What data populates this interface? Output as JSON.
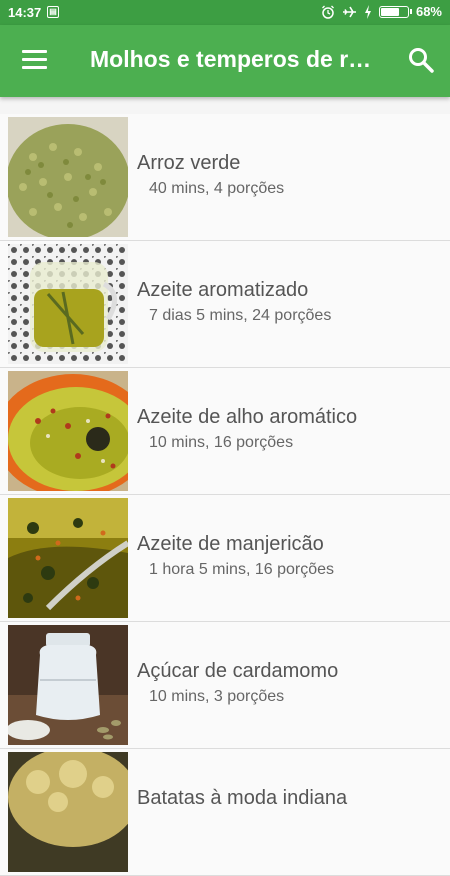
{
  "status_bar": {
    "time": "14:37",
    "sim_icon": "sim-card-icon",
    "battery": "68%",
    "battery_level": 0.68,
    "icons": [
      "alarm-icon",
      "airplane-icon",
      "charging-icon",
      "battery-icon"
    ]
  },
  "app_bar": {
    "menu_icon": "hamburger-menu-icon",
    "title": "Molhos e temperos de r…",
    "search_icon": "search-icon",
    "color": "#4caf50"
  },
  "recipes": [
    {
      "name": "Arroz verde",
      "meta": "40 mins, 4 porções",
      "image": "green-rice-photo"
    },
    {
      "name": "Azeite aromatizado",
      "meta": "7 dias 5 mins, 24 porções",
      "image": "aromatic-oil-jar-photo"
    },
    {
      "name": "Azeite de alho aromático",
      "meta": "10 mins, 16 porções",
      "image": "garlic-oil-bowl-photo"
    },
    {
      "name": "Azeite de manjericão",
      "meta": "1 hora 5 mins, 16 porções",
      "image": "basil-oil-photo"
    },
    {
      "name": "Açúcar de cardamomo",
      "meta": "10 mins, 3 porções",
      "image": "cardamom-sugar-jar-photo"
    },
    {
      "name": "Batatas à moda indiana",
      "meta": "",
      "image": "indian-potatoes-photo"
    }
  ]
}
